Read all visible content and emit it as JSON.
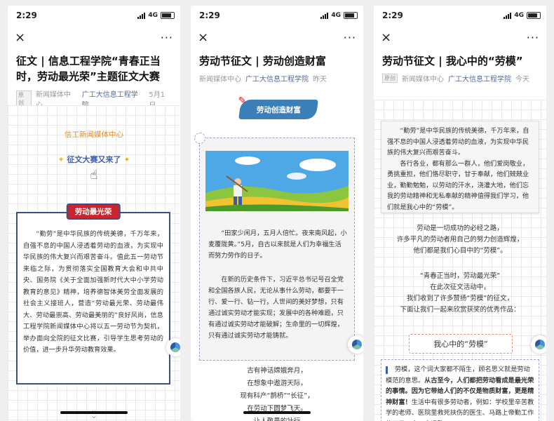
{
  "status": {
    "time": "2:29",
    "network": "4G"
  },
  "nav": {
    "close": "×",
    "more": "···"
  },
  "panel1": {
    "title": "征文 | 信息工程学院“青春正当时，劳动最光荣”主题征文大赛",
    "meta": {
      "tag": "原创",
      "source": "新闻媒体中心",
      "account": "广工大信息工程学院",
      "date": "5月1日"
    },
    "org": "信工新闻媒体中心",
    "contest": "征文大赛又来了",
    "ribbon": "劳动最光荣",
    "text": "“勤劳”是中华民族的传统美德，千万年来，自强不息的中国人浸透着劳动的血液，为实现中华民族的伟大复兴而艰苦奋斗。值此五一劳动节来临之际，为贯彻落实全国教育大会和中共中央、国务院《关于全面加强新时代大中小学劳动教育的意见》精神，培养德智体美劳全面发展的社会主义接班人，营造“劳动最光荣、劳动最伟大、劳动最崇高、劳动最美丽的”良好风尚，信息工程学院新闻媒体中心将以五一劳动节为契机，举办面向全院的征文比赛，引导学生思考劳动的价值，进一步升华劳动教育效果。"
  },
  "panel2": {
    "title": "劳动节征文 | 劳动创造财富",
    "meta": {
      "source": "新闻媒体中心",
      "account": "广工大信息工程学院",
      "date": "昨天"
    },
    "banner": "劳动创造财富",
    "text1": "“田家少闲月，五月人倍忙。夜来南风起，小麦覆陇黄。”5月，自古以来就是人们为幸福生活而努力劳作的日子。",
    "text2": "在新的历史条件下，习近平总书记号召全党和全国各族人民，无论从事什么劳动，都要干一行、爱一行、钻一行，人世间的美好梦想，只有通过诚实劳动才能实现；发展中的各种难题，只有通过诚实劳动才能破解；生命里的一切辉煌，只有通过诚实劳动才能铸就。",
    "poem": [
      "古有神话嫦娥奔月，",
      "在想象中遨游天际，",
      "现有科产“鹊桥”“长征”，",
      "在劳动下圆梦飞天。",
      "让人敬畏的壮行"
    ]
  },
  "panel3": {
    "title": "劳动节征文 | 我心中的“劳模”",
    "meta": {
      "tag": "原创",
      "source": "新闻媒体中心",
      "account": "广工大信息工程学院",
      "date": "今天"
    },
    "box1": "“勤劳”是中华民族的传统美德，千万年来，自强不息的中国人浸透着劳动的血液，为实现中华民族的伟大复兴而艰苦奋斗。",
    "box2": "各行各业，都有那么一群人，他们爱岗敬业，勇挑重担，他们恪尽职守，甘于奉献，他们兢兢业业，勤勤勉勉，以劳动的汗水，浇灌大地，他们忘我的劳动精神和无私奉献的精神值得我们学习，他们就是我心中的“劳模”。",
    "center_lines": [
      "劳动是一切成功的必经之路，",
      "许多平凡的劳动者用自己的努力创造辉煌，",
      "他们都是我们心目中的“劳模”。"
    ],
    "center2": [
      "“青春正当时，劳动最光荣”",
      "在此次征文活动中，",
      "我们收到了许多赞扬“劳模”的征文，",
      "下面让我们一起来欣赏获奖的优秀作品："
    ],
    "section": "我心中的“劳模”",
    "essay_normal": "劳模，这个词大家都不陌生，顾名思义就是劳动模范的意思。",
    "essay_bold": "从古至今，人们都把劳动看成是最光荣的事情。因为它带给人们的不仅是物质财富，更是精神财富！",
    "essay_tail": "生活中有很多劳动者，例如：学校里辛苦教学的老师、医院里救死扶伤的医生、马路上帝勤工作的环卫工人、交通警"
  }
}
